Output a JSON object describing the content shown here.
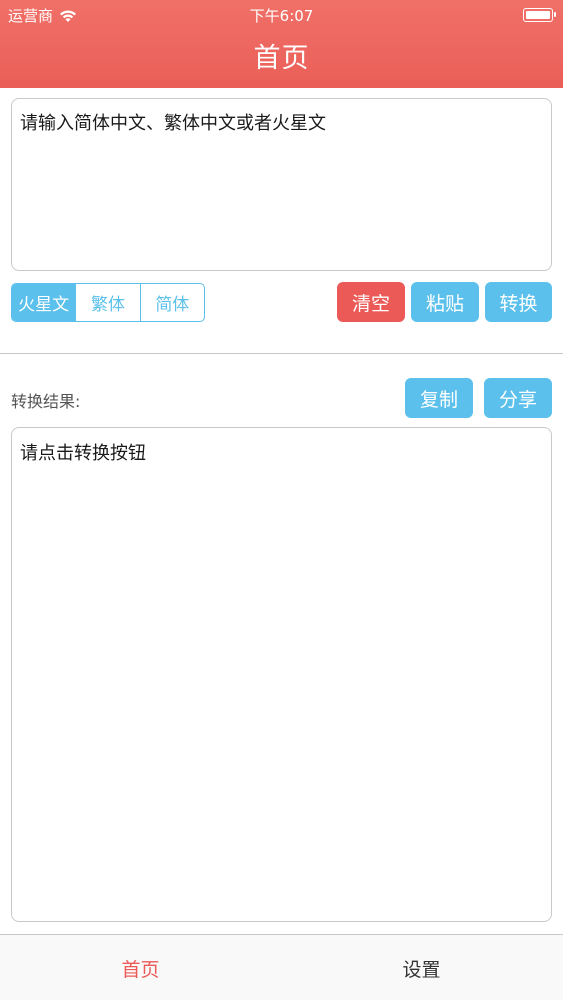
{
  "status_bar": {
    "carrier": "运营商",
    "time": "下午6:07",
    "wifi_icon": "wifi-icon",
    "battery_icon": "battery-icon"
  },
  "header": {
    "title": "首页",
    "color": "#ea5f58"
  },
  "input": {
    "placeholder": "请输入简体中文、繁体中文或者火星文"
  },
  "segment": {
    "items": [
      "火星文",
      "繁体",
      "简体"
    ],
    "selected": "火星文",
    "accent": "#5bc0eb"
  },
  "actions": {
    "clear": "清空",
    "paste": "粘贴",
    "convert": "转换"
  },
  "result": {
    "label": "转换结果:",
    "copy": "复制",
    "share": "分享",
    "placeholder": "请点击转换按钮"
  },
  "tabbar": {
    "home": "首页",
    "settings": "设置",
    "active": "首页",
    "active_color": "#ec5a57"
  }
}
